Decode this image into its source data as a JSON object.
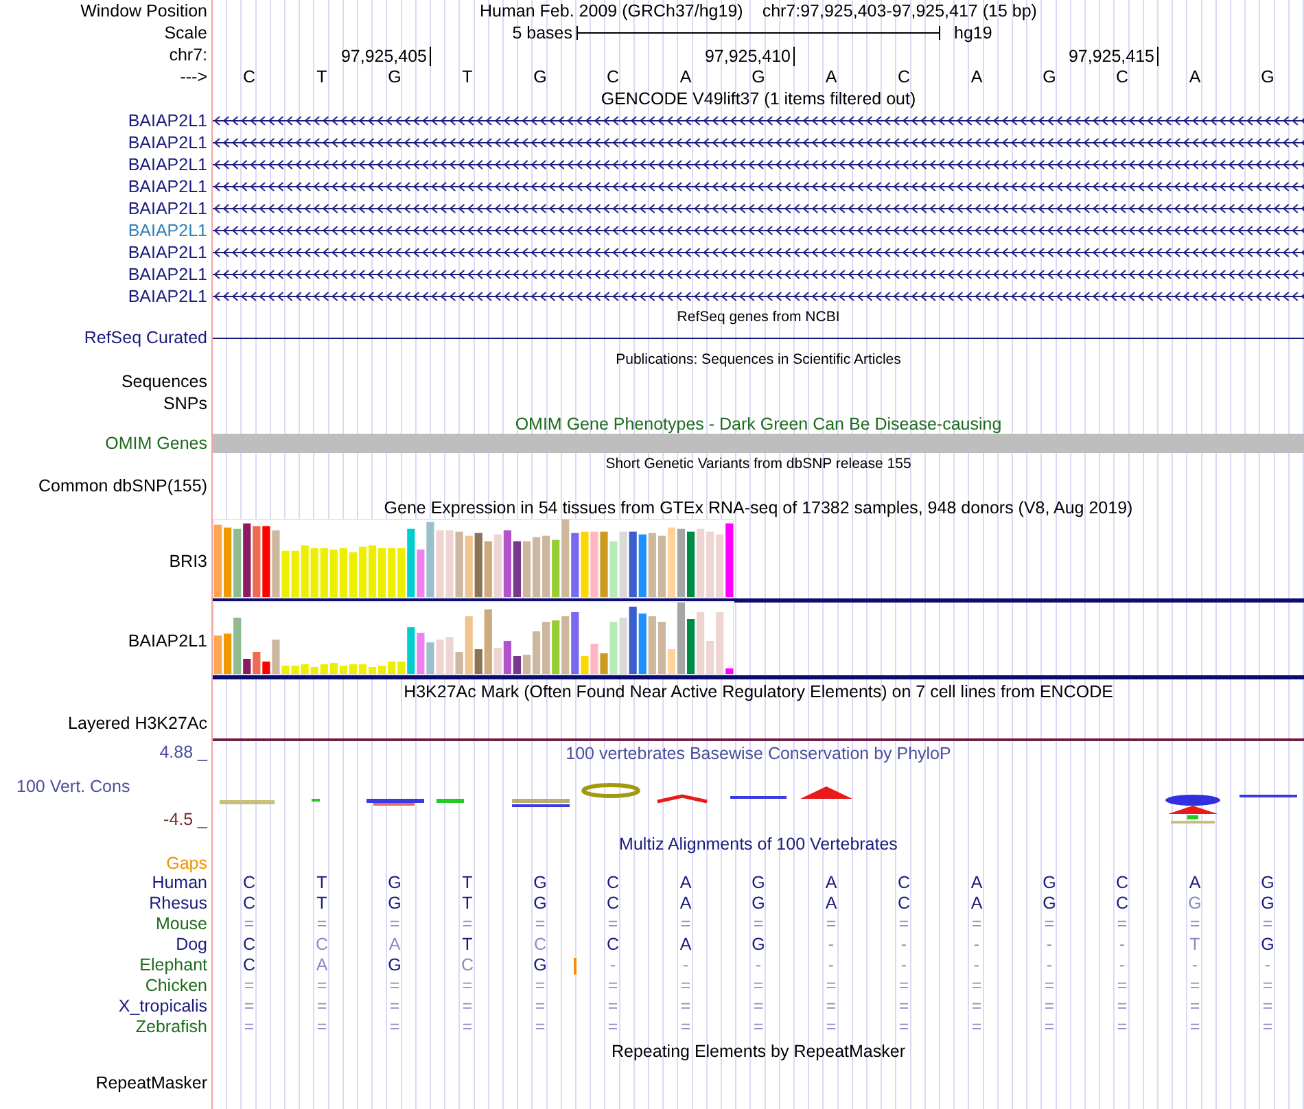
{
  "header": {
    "position_label": "Window Position",
    "assembly": "Human Feb. 2009 (GRCh37/hg19)",
    "position": "chr7:97,925,403-97,925,417 (15 bp)",
    "scale_label": "Scale",
    "scale_text": "5 bases",
    "scale_db": "hg19",
    "chrom_label": "chr7:",
    "ticks": [
      "97,925,405",
      "97,925,410",
      "97,925,415"
    ],
    "strand_label": "--->",
    "bases": [
      "C",
      "T",
      "G",
      "T",
      "G",
      "C",
      "A",
      "G",
      "A",
      "C",
      "A",
      "G",
      "C",
      "A",
      "G"
    ]
  },
  "tracks": [
    {
      "kind": "gene_stack",
      "title": "GENCODE V49lift37 (1 items filtered out)",
      "genes": [
        {
          "name": "BAIAP2L1",
          "color": "#1a1a7e"
        },
        {
          "name": "BAIAP2L1",
          "color": "#1a1a7e"
        },
        {
          "name": "BAIAP2L1",
          "color": "#1a1a7e"
        },
        {
          "name": "BAIAP2L1",
          "color": "#1a1a7e"
        },
        {
          "name": "BAIAP2L1",
          "color": "#1a1a7e"
        },
        {
          "name": "BAIAP2L1",
          "color": "#2f7fb8"
        },
        {
          "name": "BAIAP2L1",
          "color": "#1a1a7e"
        },
        {
          "name": "BAIAP2L1",
          "color": "#1a1a7e"
        },
        {
          "name": "BAIAP2L1",
          "color": "#1a1a7e"
        }
      ]
    },
    {
      "kind": "line",
      "title": "RefSeq genes from NCBI",
      "label": "RefSeq Curated",
      "color": "#1a1a7e"
    },
    {
      "kind": "annotation",
      "title": "Publications: Sequences in Scientific Articles",
      "labels": [
        "Sequences",
        "SNPs"
      ]
    },
    {
      "kind": "bar",
      "title": "OMIM Gene Phenotypes - Dark Green Can Be Disease-causing",
      "label": "OMIM Genes",
      "color": "#1c6b1c"
    },
    {
      "kind": "annotation",
      "title": "Short Genetic Variants from dbSNP release 155",
      "labels": [
        "Common dbSNP(155)"
      ]
    },
    {
      "kind": "gtex",
      "title": "Gene Expression in 54 tissues from GTEx RNA-seq of 17382 samples, 948 donors (V8, Aug 2019)",
      "charts": [
        {
          "label": "BRI3"
        },
        {
          "label": "BAIAP2L1"
        }
      ]
    },
    {
      "kind": "signal",
      "title": "H3K27Ac Mark (Often Found Near Active Regulatory Elements) on 7 cell lines from ENCODE",
      "labels": [
        "Layered H3K27Ac"
      ]
    },
    {
      "kind": "phylop",
      "title": "100 vertebrates Basewise Conservation by PhyloP",
      "label": "100 Vert. Cons",
      "ymax": "4.88 _",
      "ymin": "-4.5 _",
      "color": "#4d4d9e"
    },
    {
      "kind": "multiz",
      "title": "Multiz Alignments of 100 Vertebrates",
      "gaps_label": "Gaps",
      "color": "#1a1a7e",
      "species": [
        {
          "name": "Human",
          "color": "#1a1a7e",
          "cells": [
            {
              "base": "C",
              "dim": false,
              "insertion": false
            },
            {
              "base": "T",
              "dim": false,
              "insertion": false
            },
            {
              "base": "G",
              "dim": false,
              "insertion": false
            },
            {
              "base": "T",
              "dim": false,
              "insertion": false
            },
            {
              "base": "G",
              "dim": false,
              "insertion": false
            },
            {
              "base": "C",
              "dim": false,
              "insertion": false
            },
            {
              "base": "A",
              "dim": false,
              "insertion": false
            },
            {
              "base": "G",
              "dim": false,
              "insertion": false
            },
            {
              "base": "A",
              "dim": false,
              "insertion": false
            },
            {
              "base": "C",
              "dim": false,
              "insertion": false
            },
            {
              "base": "A",
              "dim": false,
              "insertion": false
            },
            {
              "base": "G",
              "dim": false,
              "insertion": false
            },
            {
              "base": "C",
              "dim": false,
              "insertion": false
            },
            {
              "base": "A",
              "dim": false,
              "insertion": false
            },
            {
              "base": "G",
              "dim": false,
              "insertion": false
            }
          ]
        },
        {
          "name": "Rhesus",
          "color": "#1a1a7e",
          "cells": [
            {
              "base": "C",
              "dim": false,
              "insertion": false
            },
            {
              "base": "T",
              "dim": false,
              "insertion": false
            },
            {
              "base": "G",
              "dim": false,
              "insertion": false
            },
            {
              "base": "T",
              "dim": false,
              "insertion": false
            },
            {
              "base": "G",
              "dim": false,
              "insertion": false
            },
            {
              "base": "C",
              "dim": false,
              "insertion": false
            },
            {
              "base": "A",
              "dim": false,
              "insertion": false
            },
            {
              "base": "G",
              "dim": false,
              "insertion": false
            },
            {
              "base": "A",
              "dim": false,
              "insertion": false
            },
            {
              "base": "C",
              "dim": false,
              "insertion": false
            },
            {
              "base": "A",
              "dim": false,
              "insertion": false
            },
            {
              "base": "G",
              "dim": false,
              "insertion": false
            },
            {
              "base": "C",
              "dim": false,
              "insertion": false
            },
            {
              "base": "G",
              "dim": true,
              "insertion": false
            },
            {
              "base": "G",
              "dim": false,
              "insertion": false
            }
          ]
        },
        {
          "name": "Mouse",
          "color": "#1c6b1c",
          "cells": [
            {
              "base": "=",
              "dim": true,
              "insertion": false
            },
            {
              "base": "=",
              "dim": true,
              "insertion": false
            },
            {
              "base": "=",
              "dim": true,
              "insertion": false
            },
            {
              "base": "=",
              "dim": true,
              "insertion": false
            },
            {
              "base": "=",
              "dim": true,
              "insertion": false
            },
            {
              "base": "=",
              "dim": true,
              "insertion": false
            },
            {
              "base": "=",
              "dim": true,
              "insertion": false
            },
            {
              "base": "=",
              "dim": true,
              "insertion": false
            },
            {
              "base": "=",
              "dim": true,
              "insertion": false
            },
            {
              "base": "=",
              "dim": true,
              "insertion": false
            },
            {
              "base": "=",
              "dim": true,
              "insertion": false
            },
            {
              "base": "=",
              "dim": true,
              "insertion": false
            },
            {
              "base": "=",
              "dim": true,
              "insertion": false
            },
            {
              "base": "=",
              "dim": true,
              "insertion": false
            },
            {
              "base": "=",
              "dim": true,
              "insertion": false
            }
          ]
        },
        {
          "name": "Dog",
          "color": "#1a1a7e",
          "cells": [
            {
              "base": "C",
              "dim": false,
              "insertion": false
            },
            {
              "base": "C",
              "dim": true,
              "insertion": false
            },
            {
              "base": "A",
              "dim": true,
              "insertion": false
            },
            {
              "base": "T",
              "dim": false,
              "insertion": false
            },
            {
              "base": "C",
              "dim": true,
              "insertion": false
            },
            {
              "base": "C",
              "dim": false,
              "insertion": false
            },
            {
              "base": "A",
              "dim": false,
              "insertion": false
            },
            {
              "base": "G",
              "dim": false,
              "insertion": false
            },
            {
              "base": "-",
              "dim": true,
              "insertion": false
            },
            {
              "base": "-",
              "dim": true,
              "insertion": false
            },
            {
              "base": "-",
              "dim": true,
              "insertion": false
            },
            {
              "base": "-",
              "dim": true,
              "insertion": false
            },
            {
              "base": "-",
              "dim": true,
              "insertion": false
            },
            {
              "base": "T",
              "dim": true,
              "insertion": false
            },
            {
              "base": "G",
              "dim": false,
              "insertion": false
            }
          ]
        },
        {
          "name": "Elephant",
          "color": "#1c6b1c",
          "cells": [
            {
              "base": "C",
              "dim": false,
              "insertion": false
            },
            {
              "base": "A",
              "dim": true,
              "insertion": false
            },
            {
              "base": "G",
              "dim": false,
              "insertion": false
            },
            {
              "base": "C",
              "dim": true,
              "insertion": false
            },
            {
              "base": "G",
              "dim": false,
              "insertion": true
            },
            {
              "base": "-",
              "dim": true,
              "insertion": false
            },
            {
              "base": "-",
              "dim": true,
              "insertion": false
            },
            {
              "base": "-",
              "dim": true,
              "insertion": false
            },
            {
              "base": "-",
              "dim": true,
              "insertion": false
            },
            {
              "base": "-",
              "dim": true,
              "insertion": false
            },
            {
              "base": "-",
              "dim": true,
              "insertion": false
            },
            {
              "base": "-",
              "dim": true,
              "insertion": false
            },
            {
              "base": "-",
              "dim": true,
              "insertion": false
            },
            {
              "base": "-",
              "dim": true,
              "insertion": false
            },
            {
              "base": "-",
              "dim": true,
              "insertion": false
            }
          ]
        },
        {
          "name": "Chicken",
          "color": "#1c6b1c",
          "cells": [
            {
              "base": "=",
              "dim": true,
              "insertion": false
            },
            {
              "base": "=",
              "dim": true,
              "insertion": false
            },
            {
              "base": "=",
              "dim": true,
              "insertion": false
            },
            {
              "base": "=",
              "dim": true,
              "insertion": false
            },
            {
              "base": "=",
              "dim": true,
              "insertion": false
            },
            {
              "base": "=",
              "dim": true,
              "insertion": false
            },
            {
              "base": "=",
              "dim": true,
              "insertion": false
            },
            {
              "base": "=",
              "dim": true,
              "insertion": false
            },
            {
              "base": "=",
              "dim": true,
              "insertion": false
            },
            {
              "base": "=",
              "dim": true,
              "insertion": false
            },
            {
              "base": "=",
              "dim": true,
              "insertion": false
            },
            {
              "base": "=",
              "dim": true,
              "insertion": false
            },
            {
              "base": "=",
              "dim": true,
              "insertion": false
            },
            {
              "base": "=",
              "dim": true,
              "insertion": false
            },
            {
              "base": "=",
              "dim": true,
              "insertion": false
            }
          ]
        },
        {
          "name": "X_tropicalis",
          "color": "#1a1a7e",
          "cells": [
            {
              "base": "=",
              "dim": true,
              "insertion": false
            },
            {
              "base": "=",
              "dim": true,
              "insertion": false
            },
            {
              "base": "=",
              "dim": true,
              "insertion": false
            },
            {
              "base": "=",
              "dim": true,
              "insertion": false
            },
            {
              "base": "=",
              "dim": true,
              "insertion": false
            },
            {
              "base": "=",
              "dim": true,
              "insertion": false
            },
            {
              "base": "=",
              "dim": true,
              "insertion": false
            },
            {
              "base": "=",
              "dim": true,
              "insertion": false
            },
            {
              "base": "=",
              "dim": true,
              "insertion": false
            },
            {
              "base": "=",
              "dim": true,
              "insertion": false
            },
            {
              "base": "=",
              "dim": true,
              "insertion": false
            },
            {
              "base": "=",
              "dim": true,
              "insertion": false
            },
            {
              "base": "=",
              "dim": true,
              "insertion": false
            },
            {
              "base": "=",
              "dim": true,
              "insertion": false
            },
            {
              "base": "=",
              "dim": true,
              "insertion": false
            }
          ]
        },
        {
          "name": "Zebrafish",
          "color": "#1c6b1c",
          "cells": [
            {
              "base": "=",
              "dim": true,
              "insertion": false
            },
            {
              "base": "=",
              "dim": true,
              "insertion": false
            },
            {
              "base": "=",
              "dim": true,
              "insertion": false
            },
            {
              "base": "=",
              "dim": true,
              "insertion": false
            },
            {
              "base": "=",
              "dim": true,
              "insertion": false
            },
            {
              "base": "=",
              "dim": true,
              "insertion": false
            },
            {
              "base": "=",
              "dim": true,
              "insertion": false
            },
            {
              "base": "=",
              "dim": true,
              "insertion": false
            },
            {
              "base": "=",
              "dim": true,
              "insertion": false
            },
            {
              "base": "=",
              "dim": true,
              "insertion": false
            },
            {
              "base": "=",
              "dim": true,
              "insertion": false
            },
            {
              "base": "=",
              "dim": true,
              "insertion": false
            },
            {
              "base": "=",
              "dim": true,
              "insertion": false
            },
            {
              "base": "=",
              "dim": true,
              "insertion": false
            },
            {
              "base": "=",
              "dim": true,
              "insertion": false
            }
          ]
        }
      ]
    },
    {
      "kind": "signal",
      "title": "Repeating Elements by RepeatMasker",
      "labels": [
        "RepeatMasker"
      ]
    }
  ]
}
